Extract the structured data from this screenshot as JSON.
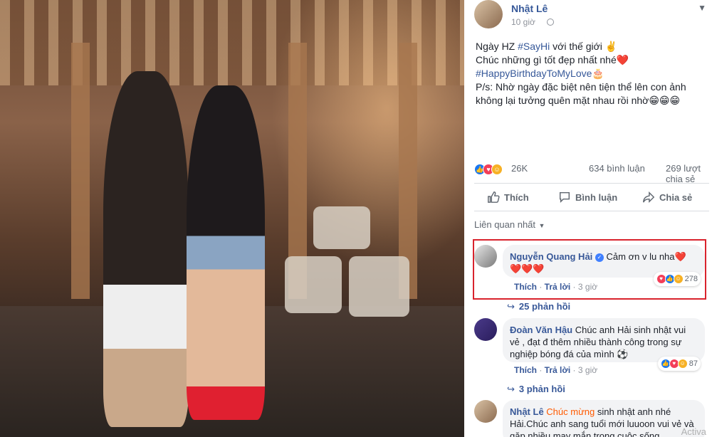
{
  "post": {
    "author": "Nhật Lê",
    "time": "10 giờ",
    "lines": {
      "l1_pre": "Ngày HZ ",
      "l1_tag": "#SayHi",
      "l1_post": " với thế giới ✌️",
      "l2": "Chúc những gì tốt đẹp nhất nhé❤️",
      "l3_tag": "#HappyBirthdayToMyLove",
      "l3_emoji": "🎂",
      "l4": "P/s: Nhờ ngày đặc biệt nên tiện thể lên con ảnh không lại tưởng quên mặt nhau rồi nhờ😁😁😁"
    },
    "reaction_total": "26K",
    "comments_count": "634 bình luận",
    "shares_count": "269 lượt chia sẻ"
  },
  "actions": {
    "like": "Thích",
    "comment": "Bình luận",
    "share": "Chia sẻ"
  },
  "sort_label": "Liên quan nhất",
  "comments": [
    {
      "author": "Nguyễn Quang Hải",
      "text": "Cảm ơn v lu nha",
      "hearts_inline": "❤️",
      "hearts_line2": "❤️❤️❤️",
      "reactions": "278",
      "like": "Thích",
      "reply": "Trả lời",
      "time": "3 giờ",
      "replies": "25 phản hồi"
    },
    {
      "author": "Đoàn Văn Hậu",
      "text": "Chúc anh Hải sinh nhật vui vẻ , đạt đ thêm nhiều thành công trong sự nghiệp bóng đá của mình ⚽",
      "reactions": "87",
      "like": "Thích",
      "reply": "Trả lời",
      "time": "3 giờ",
      "replies": "3 phản hồi"
    },
    {
      "author": "Nhật Lê",
      "highlight": "Chúc mừng",
      "text": " sinh nhật anh nhé Hải.Chúc anh sang tuổi mới luuoon vui vẻ và gặp nhiều may mắn trong cuộc sống"
    }
  ],
  "watermark": "Activa",
  "colors": {
    "link": "#365899",
    "highlight_box": "#d9232d",
    "mention_orange": "#ff5a00"
  }
}
